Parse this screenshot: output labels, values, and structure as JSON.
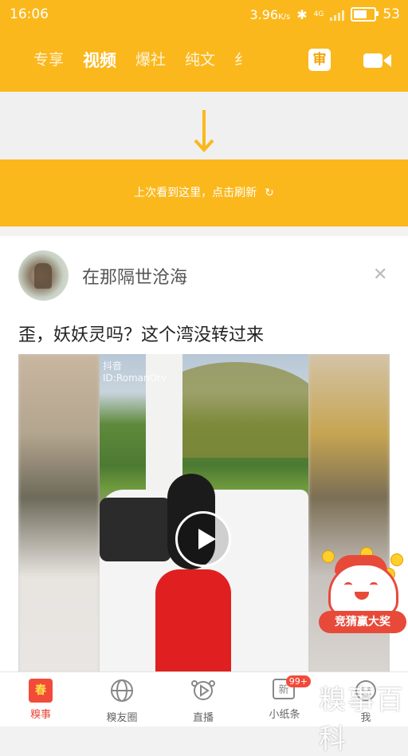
{
  "status": {
    "time": "16:06",
    "speed": "3.96",
    "speed_unit": "K/s",
    "network": "4G",
    "battery": "53"
  },
  "nav": {
    "tabs": [
      "专享",
      "视频",
      "爆社",
      "纯文",
      "纟"
    ],
    "active_tab": "视频",
    "review_label": "审"
  },
  "refresh": {
    "text": "上次看到这里，点击刷新"
  },
  "post": {
    "username": "在那隔世沧海",
    "title": "歪，妖妖灵吗？这个湾没转过来",
    "video_watermark": "抖音",
    "video_id": "ID:RomanOrv"
  },
  "promo": {
    "label": "竞猜赢大奖"
  },
  "bottom_nav": {
    "items": [
      {
        "label": "糗事",
        "icon": "spring-festival-icon",
        "active": true
      },
      {
        "label": "糗友圈",
        "icon": "globe-icon",
        "active": false
      },
      {
        "label": "直播",
        "icon": "live-icon",
        "active": false
      },
      {
        "label": "小纸条",
        "icon": "message-icon",
        "active": false
      },
      {
        "label": "我",
        "icon": "profile-icon",
        "active": false
      }
    ],
    "message_badge": "99+",
    "spring_icon_text": "春",
    "message_icon_text": "新"
  },
  "site_watermark": "糗事百科",
  "colors": {
    "brand": "#fbb81c",
    "accent": "#e84a3a"
  }
}
